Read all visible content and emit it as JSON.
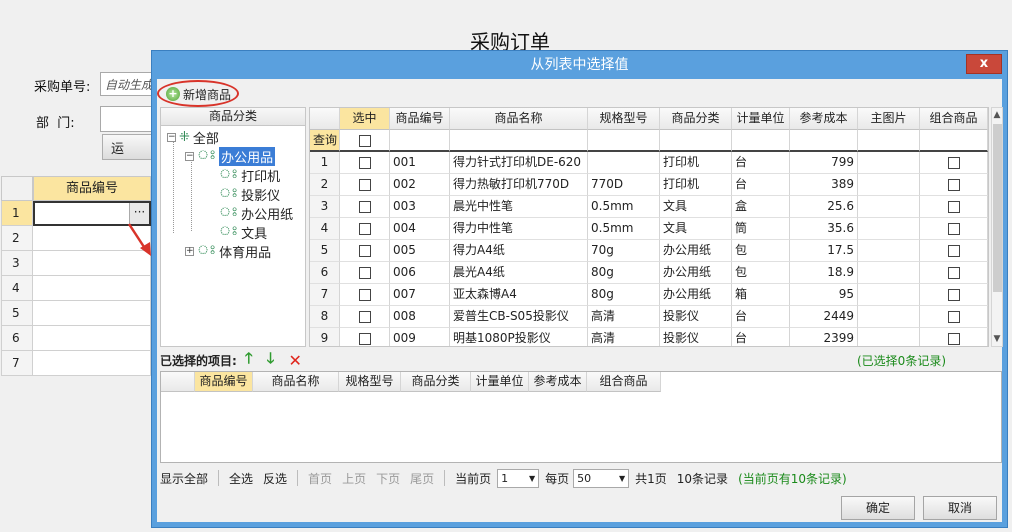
{
  "background": {
    "title": "采购订单",
    "order_label": "采购单号:",
    "order_value": "自动生成",
    "dept_label": "部  门:",
    "dept_value": "",
    "btn_label": "运",
    "grid_header": "商品编号",
    "row_numbers": [
      "1",
      "2",
      "3",
      "4",
      "5",
      "6",
      "7"
    ],
    "ellipsis": "···"
  },
  "dialog": {
    "title": "从列表中选择值",
    "close_label": "x",
    "add_button": "新增商品",
    "tree": {
      "header": "商品分类",
      "root": "全部",
      "office": "办公用品",
      "office_children": [
        "打印机",
        "投影仪",
        "办公用纸",
        "文具"
      ],
      "sports": "体育用品"
    },
    "grid": {
      "columns": [
        "选中",
        "商品编号",
        "商品名称",
        "规格型号",
        "商品分类",
        "计量单位",
        "参考成本",
        "主图片",
        "组合商品"
      ],
      "filter_label": "查询",
      "rows": [
        {
          "n": "1",
          "code": "001",
          "name": "得力针式打印机DE-620",
          "spec": "",
          "cat": "打印机",
          "unit": "台",
          "cost": "799"
        },
        {
          "n": "2",
          "code": "002",
          "name": "得力热敏打印机770D",
          "spec": "770D",
          "cat": "打印机",
          "unit": "台",
          "cost": "389"
        },
        {
          "n": "3",
          "code": "003",
          "name": "晨光中性笔",
          "spec": "0.5mm",
          "cat": "文具",
          "unit": "盒",
          "cost": "25.6"
        },
        {
          "n": "4",
          "code": "004",
          "name": "得力中性笔",
          "spec": "0.5mm",
          "cat": "文具",
          "unit": "筒",
          "cost": "35.6"
        },
        {
          "n": "5",
          "code": "005",
          "name": "得力A4纸",
          "spec": "70g",
          "cat": "办公用纸",
          "unit": "包",
          "cost": "17.5"
        },
        {
          "n": "6",
          "code": "006",
          "name": "晨光A4纸",
          "spec": "80g",
          "cat": "办公用纸",
          "unit": "包",
          "cost": "18.9"
        },
        {
          "n": "7",
          "code": "007",
          "name": "亚太森博A4",
          "spec": "80g",
          "cat": "办公用纸",
          "unit": "箱",
          "cost": "95"
        },
        {
          "n": "8",
          "code": "008",
          "name": "爱普生CB-S05投影仪",
          "spec": "高清",
          "cat": "投影仪",
          "unit": "台",
          "cost": "2449"
        },
        {
          "n": "9",
          "code": "009",
          "name": "明基1080P投影仪",
          "spec": "高清",
          "cat": "投影仪",
          "unit": "台",
          "cost": "2399"
        }
      ]
    },
    "selected": {
      "title": "已选择的项目:",
      "count": "(已选择0条记录)",
      "columns": [
        "商品编号",
        "商品名称",
        "规格型号",
        "商品分类",
        "计量单位",
        "参考成本",
        "组合商品"
      ]
    },
    "pager": {
      "show_all": "显示全部",
      "select_all": "全选",
      "invert": "反选",
      "first": "首页",
      "prev": "上页",
      "next": "下页",
      "last": "尾页",
      "current_label": "当前页",
      "current_value": "1",
      "per_page_label": "每页",
      "per_page_value": "50",
      "total_pages": "共1页",
      "total_records": "10条记录",
      "page_records": "(当前页有10条记录)"
    },
    "ok": "确定",
    "cancel": "取消"
  },
  "colors": {
    "dialog_title_bg": "#5aa0de",
    "highlight": "#fbe5a0",
    "close_bg": "#c9483a",
    "tree_selected": "#3b7dd6"
  }
}
